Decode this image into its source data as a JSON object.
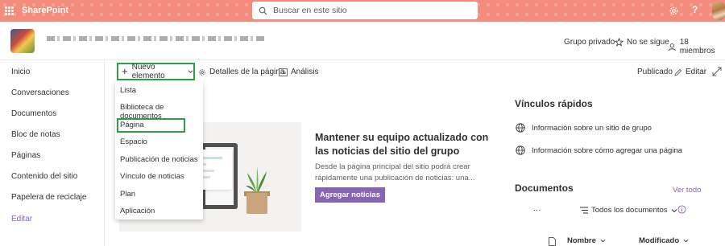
{
  "suitebar": {
    "app_name": "SharePoint",
    "search_placeholder": "Buscar en este sitio",
    "help": "?",
    "accent_color": "#f48c7e"
  },
  "site_header": {
    "privacy": "Grupo privado",
    "follow": "No se sigue",
    "members": "18 miembros"
  },
  "leftnav": {
    "items": [
      {
        "label": "Inicio"
      },
      {
        "label": "Conversaciones"
      },
      {
        "label": "Documentos"
      },
      {
        "label": "Bloc de notas"
      },
      {
        "label": "Páginas"
      },
      {
        "label": "Contenido del sitio"
      },
      {
        "label": "Papelera de reciclaje"
      }
    ],
    "edit": "Editar"
  },
  "commandbar": {
    "new_item": "Nuevo elemento",
    "page_details": "Detalles de la página",
    "analytics": "Análisis",
    "published": "Publicado",
    "edit": "Editar"
  },
  "dropdown": {
    "items": [
      {
        "label": "Lista"
      },
      {
        "label": "Biblioteca de documentos"
      },
      {
        "label": "Página"
      },
      {
        "label": "Espacio"
      },
      {
        "label": "Publicación de noticias"
      },
      {
        "label": "Vínculo de noticias"
      },
      {
        "label": "Plan"
      },
      {
        "label": "Aplicación"
      }
    ],
    "highlighted": "Página",
    "highlight_color": "#2ea043"
  },
  "news": {
    "title": "Mantener su equipo actualizado con las noticias del sitio del grupo",
    "description": "Desde la página principal del sitio podrá crear rápidamente una publicación de noticias: una...",
    "button": "Agregar noticias",
    "button_color": "#8764b8"
  },
  "quick_links": {
    "title": "Vínculos rápidos",
    "items": [
      {
        "label": "Información sobre un sitio de grupo",
        "icon": "globe-icon"
      },
      {
        "label": "Información sobre cómo agregar una página",
        "icon": "globe-icon"
      }
    ]
  },
  "documents": {
    "title": "Documentos",
    "see_all": "Ver todo",
    "more": "···",
    "view": "Todos los documentos",
    "columns": [
      "Nombre",
      "Modificado"
    ]
  }
}
